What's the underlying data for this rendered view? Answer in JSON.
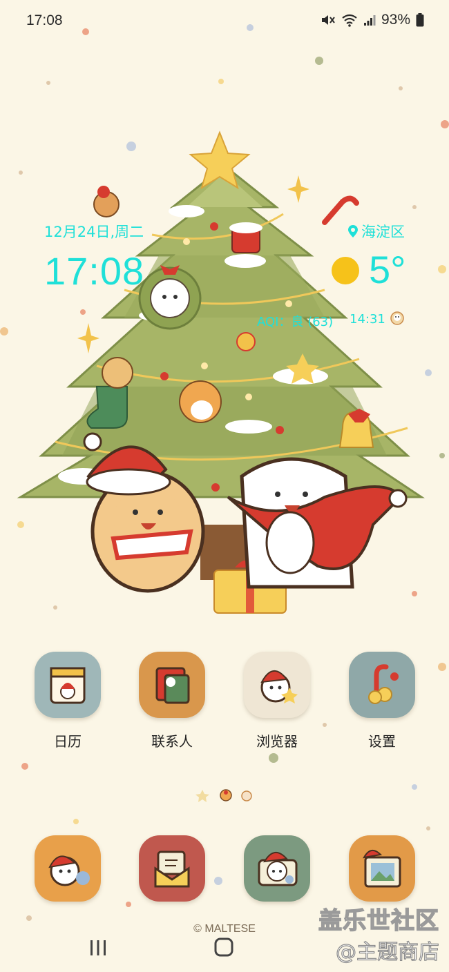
{
  "status_bar": {
    "time": "17:08",
    "battery": "93%",
    "icons": [
      "mute-icon",
      "wifi-icon",
      "signal-icon",
      "battery-icon"
    ]
  },
  "weather_widget": {
    "date": "12月24日,周二",
    "location": "海淀区",
    "time": "17:08",
    "temperature": "5°",
    "aqi": "AQI：良 (63)",
    "updated": "14:31",
    "text_color": "#1fe0d8",
    "weather_icon": "sun-icon"
  },
  "apps": [
    {
      "label": "日历",
      "icon": "calendar-icon",
      "bg": "#9fb7b8"
    },
    {
      "label": "联系人",
      "icon": "contacts-icon",
      "bg": "#d9974c"
    },
    {
      "label": "浏览器",
      "icon": "browser-icon",
      "bg": "#efe6d4"
    },
    {
      "label": "设置",
      "icon": "settings-icon",
      "bg": "#8fa8a8"
    }
  ],
  "dock": [
    {
      "icon": "phone-icon",
      "bg": "#e8a04a"
    },
    {
      "icon": "messages-icon",
      "bg": "#c0584e"
    },
    {
      "icon": "camera-icon",
      "bg": "#7c9a80"
    },
    {
      "icon": "gallery-icon",
      "bg": "#e29a48"
    }
  ],
  "copyright": "© MALTESE",
  "watermark": {
    "line1": "盖乐世社区",
    "line2": "@主题商店"
  }
}
